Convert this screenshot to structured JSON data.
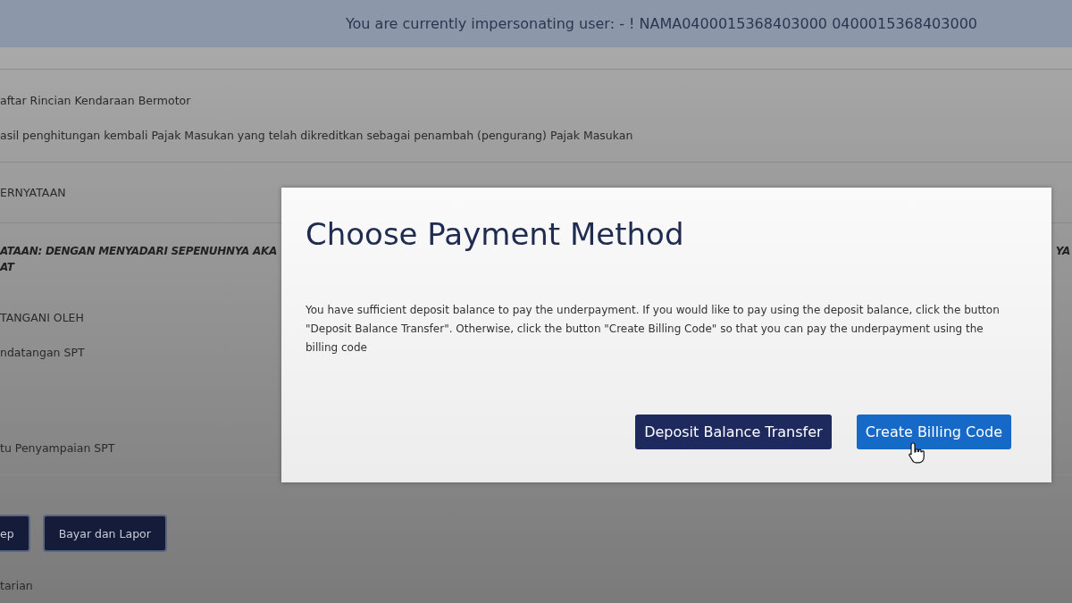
{
  "banner": {
    "text": "You are currently impersonating user: - ! NAMA0400015368403000 0400015368403000"
  },
  "form": {
    "rows": [
      {
        "kind": "text",
        "text": "aftar Rincian Kendaraan Bermotor"
      },
      {
        "kind": "text",
        "text": "asil penghitungan kembali Pajak Masukan yang telah dikreditkan sebagai penambah (pengurang) Pajak Masukan"
      },
      {
        "kind": "rule"
      },
      {
        "kind": "heading",
        "text": "ERNYATAAN"
      },
      {
        "kind": "rule"
      },
      {
        "kind": "statement",
        "text": "ATAAN: DENGAN MENYADARI SEPENUHNYA AKA",
        "continuation": "AT",
        "right": "YA"
      },
      {
        "kind": "text",
        "text": "TANGANI OLEH"
      },
      {
        "kind": "text",
        "text": "ndatangan SPT"
      },
      {
        "kind": "spacer"
      },
      {
        "kind": "text",
        "text": "tu Penyampaian SPT"
      },
      {
        "kind": "rule"
      }
    ],
    "buttons": [
      "ep",
      "Bayar dan Lapor"
    ],
    "footer": "tarian"
  },
  "modal": {
    "title": "Choose Payment Method",
    "message": "You have sufficient deposit balance to pay the underpayment. If you would like to pay using the deposit balance, click the button \"Deposit Balance Transfer\". Otherwise, click the button \"Create Billing Code\" so that you can pay the underpayment using the billing code",
    "buttons": [
      {
        "label": "Deposit Balance Transfer",
        "kind": "secondary"
      },
      {
        "label": "Create Billing Code",
        "kind": "primary"
      }
    ]
  }
}
